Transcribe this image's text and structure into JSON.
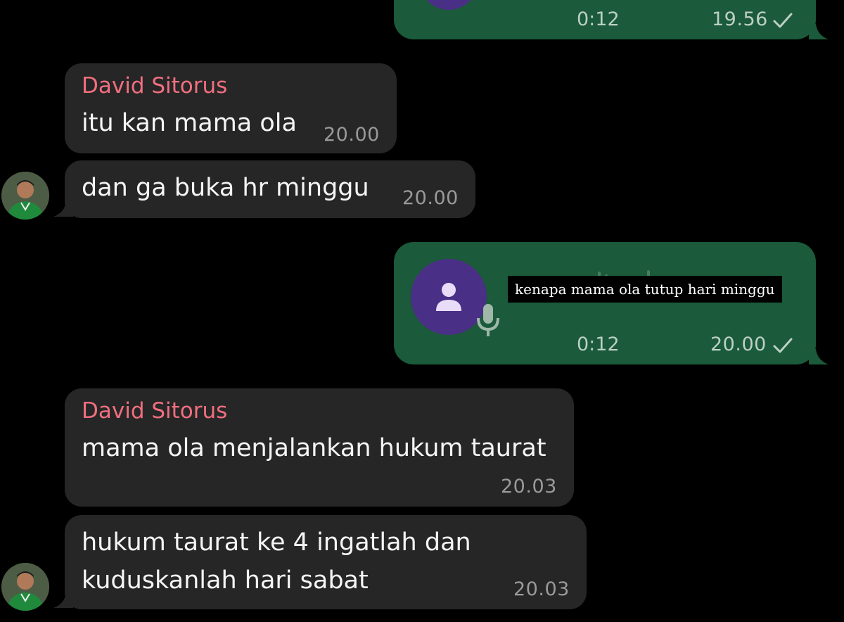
{
  "colors": {
    "background": "#000000",
    "incoming_bubble": "#262626",
    "outgoing_bubble": "#1b5a3a",
    "sender_name": "#f06f7f",
    "voice_avatar": "#4a2f86"
  },
  "messages": [
    {
      "direction": "outgoing",
      "type": "voice",
      "duration": "0:12",
      "time": "19.56",
      "status": "sent"
    },
    {
      "direction": "incoming",
      "sender": "David Sitorus",
      "text": "itu kan mama ola",
      "time": "20.00"
    },
    {
      "direction": "incoming",
      "text": "dan ga buka hr minggu",
      "time": "20.00"
    },
    {
      "direction": "outgoing",
      "type": "voice",
      "caption": "kenapa mama ola tutup hari minggu",
      "duration": "0:12",
      "time": "20.00",
      "status": "sent"
    },
    {
      "direction": "incoming",
      "sender": "David Sitorus",
      "text": "mama ola menjalankan hukum taurat",
      "time": "20.03"
    },
    {
      "direction": "incoming",
      "text_lines": [
        "hukum taurat ke 4 ingatlah dan",
        "kuduskanlah hari sabat"
      ],
      "time": "20.03"
    }
  ],
  "icons": {
    "voice_avatar": "person-icon",
    "microphone": "microphone-icon",
    "status": "check-icon"
  }
}
